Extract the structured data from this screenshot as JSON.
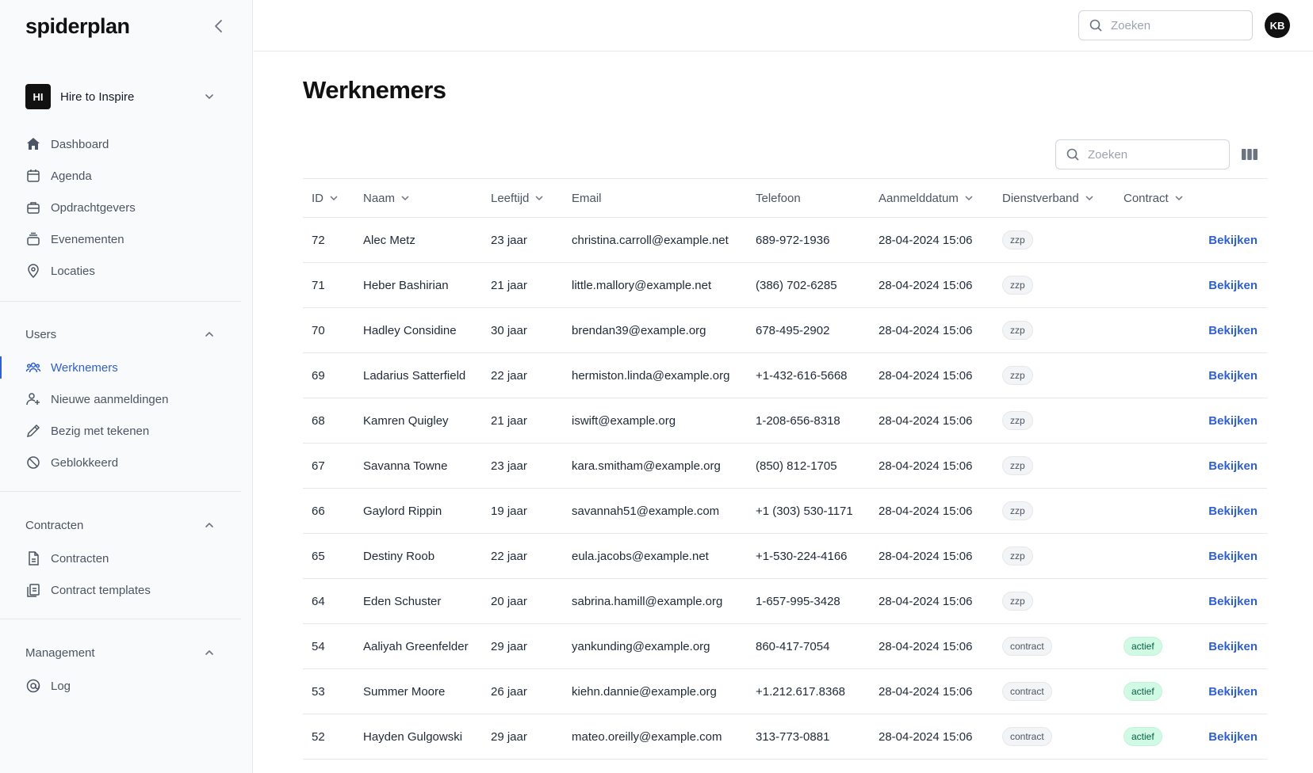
{
  "app": {
    "logo": "spiderplan"
  },
  "org": {
    "initials": "HI",
    "name": "Hire to Inspire"
  },
  "nav_main": [
    {
      "label": "Dashboard",
      "icon": "home-icon"
    },
    {
      "label": "Agenda",
      "icon": "calendar-icon"
    },
    {
      "label": "Opdrachtgevers",
      "icon": "briefcase-icon"
    },
    {
      "label": "Evenementen",
      "icon": "stack-icon"
    },
    {
      "label": "Locaties",
      "icon": "map-pin-icon"
    }
  ],
  "sections": {
    "users": {
      "title": "Users",
      "items": [
        {
          "label": "Werknemers",
          "icon": "users-icon",
          "active": true
        },
        {
          "label": "Nieuwe aanmeldingen",
          "icon": "user-plus-icon"
        },
        {
          "label": "Bezig met tekenen",
          "icon": "pencil-icon"
        },
        {
          "label": "Geblokkeerd",
          "icon": "block-icon"
        }
      ]
    },
    "contracten": {
      "title": "Contracten",
      "items": [
        {
          "label": "Contracten",
          "icon": "document-icon"
        },
        {
          "label": "Contract templates",
          "icon": "clipboard-icon"
        }
      ]
    },
    "management": {
      "title": "Management",
      "items": [
        {
          "label": "Log",
          "icon": "at-sign-icon"
        }
      ]
    }
  },
  "topbar": {
    "search_placeholder": "Zoeken",
    "avatar_initials": "KB"
  },
  "page": {
    "title": "Werknemers",
    "search_placeholder": "Zoeken"
  },
  "table": {
    "columns": {
      "id": "ID",
      "name": "Naam",
      "age": "Leeftijd",
      "email": "Email",
      "phone": "Telefoon",
      "date": "Aanmelddatum",
      "dienst": "Dienstverband",
      "contract": "Contract"
    },
    "action_label": "Bekijken",
    "rows": [
      {
        "id": "72",
        "name": "Alec Metz",
        "age": "23 jaar",
        "email": "christina.carroll@example.net",
        "phone": "689-972-1936",
        "date": "28-04-2024 15:06",
        "dienst": "zzp",
        "contract": ""
      },
      {
        "id": "71",
        "name": "Heber Bashirian",
        "age": "21 jaar",
        "email": "little.mallory@example.net",
        "phone": "(386) 702-6285",
        "date": "28-04-2024 15:06",
        "dienst": "zzp",
        "contract": ""
      },
      {
        "id": "70",
        "name": "Hadley Considine",
        "age": "30 jaar",
        "email": "brendan39@example.org",
        "phone": "678-495-2902",
        "date": "28-04-2024 15:06",
        "dienst": "zzp",
        "contract": ""
      },
      {
        "id": "69",
        "name": "Ladarius Satterfield",
        "age": "22 jaar",
        "email": "hermiston.linda@example.org",
        "phone": "+1-432-616-5668",
        "date": "28-04-2024 15:06",
        "dienst": "zzp",
        "contract": ""
      },
      {
        "id": "68",
        "name": "Kamren Quigley",
        "age": "21 jaar",
        "email": "iswift@example.org",
        "phone": "1-208-656-8318",
        "date": "28-04-2024 15:06",
        "dienst": "zzp",
        "contract": ""
      },
      {
        "id": "67",
        "name": "Savanna Towne",
        "age": "23 jaar",
        "email": "kara.smitham@example.org",
        "phone": "(850) 812-1705",
        "date": "28-04-2024 15:06",
        "dienst": "zzp",
        "contract": ""
      },
      {
        "id": "66",
        "name": "Gaylord Rippin",
        "age": "19 jaar",
        "email": "savannah51@example.com",
        "phone": "+1 (303) 530-1171",
        "date": "28-04-2024 15:06",
        "dienst": "zzp",
        "contract": ""
      },
      {
        "id": "65",
        "name": "Destiny Roob",
        "age": "22 jaar",
        "email": "eula.jacobs@example.net",
        "phone": "+1-530-224-4166",
        "date": "28-04-2024 15:06",
        "dienst": "zzp",
        "contract": ""
      },
      {
        "id": "64",
        "name": "Eden Schuster",
        "age": "20 jaar",
        "email": "sabrina.hamill@example.org",
        "phone": "1-657-995-3428",
        "date": "28-04-2024 15:06",
        "dienst": "zzp",
        "contract": ""
      },
      {
        "id": "54",
        "name": "Aaliyah Greenfelder",
        "age": "29 jaar",
        "email": "yankunding@example.org",
        "phone": "860-417-7054",
        "date": "28-04-2024 15:06",
        "dienst": "contract",
        "contract": "actief"
      },
      {
        "id": "53",
        "name": "Summer Moore",
        "age": "26 jaar",
        "email": "kiehn.dannie@example.org",
        "phone": "+1.212.617.8368",
        "date": "28-04-2024 15:06",
        "dienst": "contract",
        "contract": "actief"
      },
      {
        "id": "52",
        "name": "Hayden Gulgowski",
        "age": "29 jaar",
        "email": "mateo.oreilly@example.com",
        "phone": "313-773-0881",
        "date": "28-04-2024 15:06",
        "dienst": "contract",
        "contract": "actief"
      }
    ]
  },
  "colors": {
    "accent": "#2f5fd0",
    "active_badge_bg": "#d1fae5",
    "active_badge_fg": "#065f46"
  }
}
